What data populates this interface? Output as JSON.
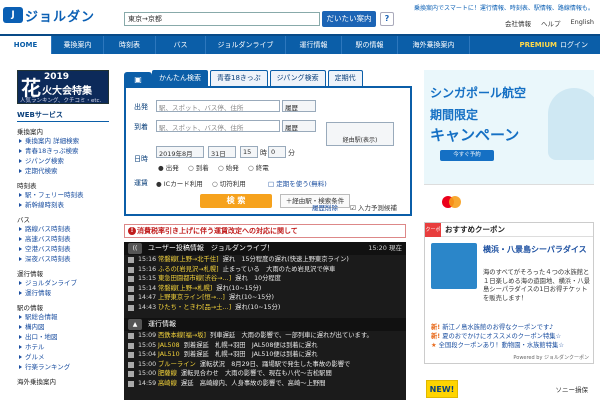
{
  "header": {
    "logo_mark": "J",
    "logo_text": "ジョルダン",
    "search_value": "東京→京都",
    "search_button": "だいたい案内",
    "help_icon": "?",
    "tagline": "乗換案内でスマートに！運行情報、時刻表、駅情報、路線情報も。",
    "links": [
      "会社情報",
      "ヘルプ",
      "English"
    ]
  },
  "nav": {
    "items": [
      "HOME",
      "乗換案内",
      "時刻表",
      "バス",
      "ジョルダンライブ",
      "運行情報",
      "駅の情報",
      "海外乗換案内"
    ],
    "premium": "PREMIUM",
    "login": "ログイン"
  },
  "sidebar": {
    "banner_kanji": "花",
    "banner_year": "2019",
    "banner_title": "火大会特集",
    "banner_sub": "人気ランキング、クチコミ・etc.",
    "title": "WEBサービス",
    "sections": [
      {
        "name": "乗換案内",
        "items": [
          "乗換案内 詳細検索",
          "青春18きっぷ検索",
          "ジパング検索",
          "定期代検索"
        ]
      },
      {
        "name": "時刻表",
        "items": [
          "駅・フェリー時刻表",
          "新幹線時刻表"
        ]
      },
      {
        "name": "バス",
        "items": [
          "路線バス時刻表",
          "高速バス時刻表",
          "空港バス時刻表",
          "深夜バス時刻表"
        ]
      },
      {
        "name": "運行情報",
        "items": [
          "ジョルダンライブ",
          "運行情報"
        ]
      },
      {
        "name": "駅の情報",
        "items": [
          "駅総合情報",
          "構内図",
          "出口・地図",
          "ホテル",
          "グルメ",
          "行楽ランキング"
        ]
      },
      {
        "name": "海外乗換案内",
        "items": []
      }
    ]
  },
  "search": {
    "tabs": [
      "かんたん検索",
      "青春18きっぷ",
      "ジパング検索",
      "定期代"
    ],
    "train_icon": "▣",
    "from_label": "出発",
    "to_label": "到着",
    "from_placeholder": "駅、スポット、バス停、住所",
    "to_placeholder": "駅、スポット、バス停、住所",
    "history_label": "履歴",
    "swap_label": "経由駅(表示)",
    "date_label": "日時",
    "year_month": "2019年8月",
    "day": "31日",
    "hour": "15",
    "hour_unit": "時",
    "minute": "0",
    "minute_unit": "分",
    "time_options": [
      "出発",
      "到着",
      "始発",
      "終電"
    ],
    "fare_label": "運賃",
    "fare_options": [
      "ICカード利用",
      "切符利用"
    ],
    "commuter_label": "定期を使う(無料)",
    "search_button": "検 索",
    "add_button": "＋経由駅・検索条件",
    "history_link": "履歴削除",
    "input_link": "入力予測候補"
  },
  "notice": "消費税率引き上げに伴う運賃改定への対応に関して",
  "live": {
    "icon": "((",
    "title": "ユーザー投稿情報　ジョルダンライブ！",
    "time": "15:20 現在",
    "rows": [
      {
        "time": "15:16",
        "line": "常磐線[上野→北千住]",
        "text": "遅れ　15分程度の遅れ(快速上野東京ライン)"
      },
      {
        "time": "15:16",
        "line": "ふるの[岩見沢→札幌]",
        "text": "止まっている　大雨のため岩見沢で停車"
      },
      {
        "time": "15:15",
        "line": "東急田園都市線[渋谷→…]",
        "text": "遅れ　10分程度"
      },
      {
        "time": "15:14",
        "line": "常磐線[上野→札幌]",
        "text": "遅れ(10~15分)"
      },
      {
        "time": "14:47",
        "line": "上野東京ライン[恒→…]",
        "text": "遅れ(10~15分)"
      },
      {
        "time": "14:43",
        "line": "ひたち・ときわ[品→土…]",
        "text": "遅れ(10~15分)"
      }
    ]
  },
  "operation": {
    "icon": "▲",
    "title": "運行情報",
    "rows": [
      {
        "time": "15:09",
        "line": "西鉄本線[福→坂]",
        "text": "列車遅延　大雨の影響で、一部列車に遅れが出ています。"
      },
      {
        "time": "15:05",
        "line": "JAL508",
        "text": "到着遅延　札幌→羽田　JAL508便は到着に遅れ"
      },
      {
        "time": "15:04",
        "line": "JAL510",
        "text": "到着遅延　札幌→羽田　JAL510便は到着に遅れ"
      },
      {
        "time": "15:00",
        "line": "ブルーライン",
        "text": "運転状況　8月29日、踊場駅で発生した事故の影響で"
      },
      {
        "time": "15:00",
        "line": "肥薩線",
        "text": "運転見合わせ　大雨の影響で、現在も八代～吉松駅間"
      },
      {
        "time": "14:59",
        "line": "高崎線",
        "text": "遅延　高崎線内、人身事故の影響で、高崎～上野間"
      }
    ]
  },
  "ad": {
    "line1": "シンガポール航空",
    "line2": "期間限定",
    "line3": "キャンペーン",
    "button": "今すぐ予約"
  },
  "coupon": {
    "tag": "クーポン",
    "title": "おすすめクーポン",
    "item_title": "横浜・八景島シーパラダイス",
    "item_desc": "海のすべてがそろった４つの水族館と１日楽しめる海の遊園地、横浜・八景島シーパラダイスの1日お得チケットを販売します！",
    "links": [
      {
        "tag": "新!",
        "text": "新江ノ島水族館のお得なクーポンです♪"
      },
      {
        "tag": "新!",
        "text": "夏のおでかけにオススメのクーポン特集☆"
      },
      {
        "tag": "★",
        "text": "全国段クーポンあり！動物園・水族館特集☆"
      }
    ],
    "powered": "Powered by ジョルダンクーポン"
  },
  "bottom": {
    "new_badge": "NEW!",
    "sony": "ソニー損保"
  }
}
